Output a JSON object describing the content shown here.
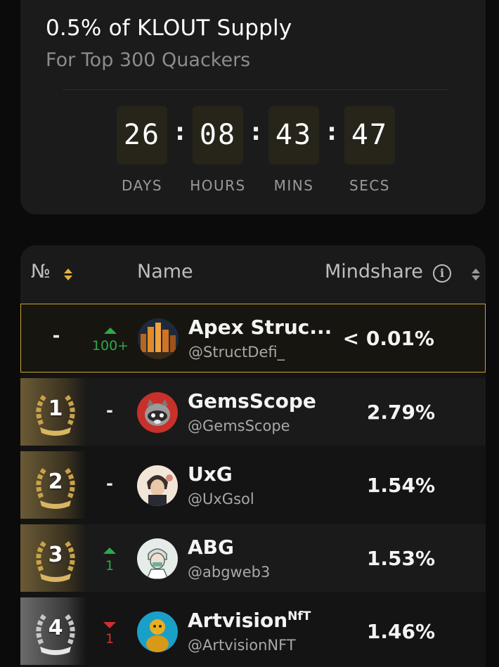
{
  "reward": {
    "title": "0.5% of KLOUT Supply",
    "subtitle": "For Top 300 Quackers"
  },
  "countdown": {
    "days": "26",
    "hours": "08",
    "mins": "43",
    "secs": "47",
    "separator": ":",
    "labels": {
      "days": "DAYS",
      "hours": "HOURS",
      "mins": "MINS",
      "secs": "SECS"
    }
  },
  "table": {
    "headers": {
      "rank": "№",
      "name": "Name",
      "mindshare": "Mindshare"
    },
    "info_symbol": "i",
    "rows": [
      {
        "rank": "-",
        "change_dir": "up",
        "change": "100+",
        "name": "Apex Struc...",
        "handle": "@StructDefi_",
        "mindshare": "< 0.01%",
        "avatar_icon": "city-avatar-icon"
      },
      {
        "rank": "1",
        "change_dir": "none",
        "change": "-",
        "name": "GemsScope",
        "handle": "@GemsScope",
        "mindshare": "2.79%",
        "avatar_icon": "raccoon-avatar-icon"
      },
      {
        "rank": "2",
        "change_dir": "none",
        "change": "-",
        "name": "UxG",
        "handle": "@UxGsol",
        "mindshare": "1.54%",
        "avatar_icon": "anime-character-avatar-icon"
      },
      {
        "rank": "3",
        "change_dir": "up",
        "change": "1",
        "name": "ABG",
        "handle": "@abgweb3",
        "mindshare": "1.53%",
        "avatar_icon": "masked-character-avatar-icon"
      },
      {
        "rank": "4",
        "change_dir": "down",
        "change": "1",
        "name": "Artvision",
        "name_sup": "NfT",
        "handle": "@ArtvisionNFT",
        "mindshare": "1.46%",
        "avatar_icon": "golden-figure-avatar-icon"
      }
    ]
  },
  "colors": {
    "accent_gold": "#e6b23a",
    "up_green": "#2fa84a",
    "down_red": "#d12f2f",
    "highlight_border": "#c9a534"
  }
}
